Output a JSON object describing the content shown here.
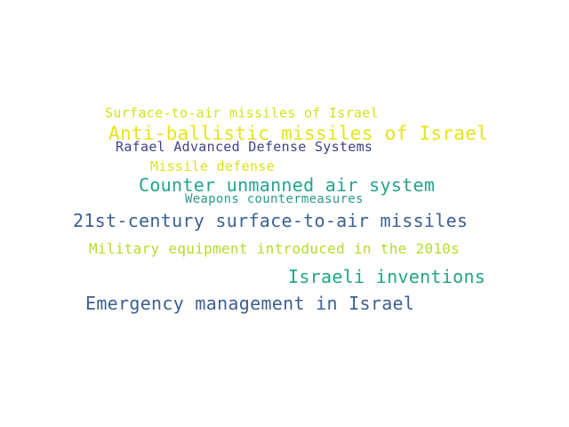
{
  "words": [
    {
      "text": "Surface-to-air missiles of Israel",
      "color": "#d2e21b"
    },
    {
      "text": "Anti-ballistic missiles of Israel",
      "color": "#e6e419"
    },
    {
      "text": "Rafael Advanced Defense Systems",
      "color": "#404387"
    },
    {
      "text": "Missile defense",
      "color": "#d8e219"
    },
    {
      "text": "Counter unmanned air system",
      "color": "#25a38a"
    },
    {
      "text": "Weapons countermeasures",
      "color": "#2a9c8a"
    },
    {
      "text": "21st-century surface-to-air missiles",
      "color": "#3b6191"
    },
    {
      "text": "Military equipment introduced in the 2010s",
      "color": "#b3dc2b"
    },
    {
      "text": "Israeli inventions",
      "color": "#22a584"
    },
    {
      "text": "Emergency management in Israel",
      "color": "#3d5f8f"
    }
  ]
}
